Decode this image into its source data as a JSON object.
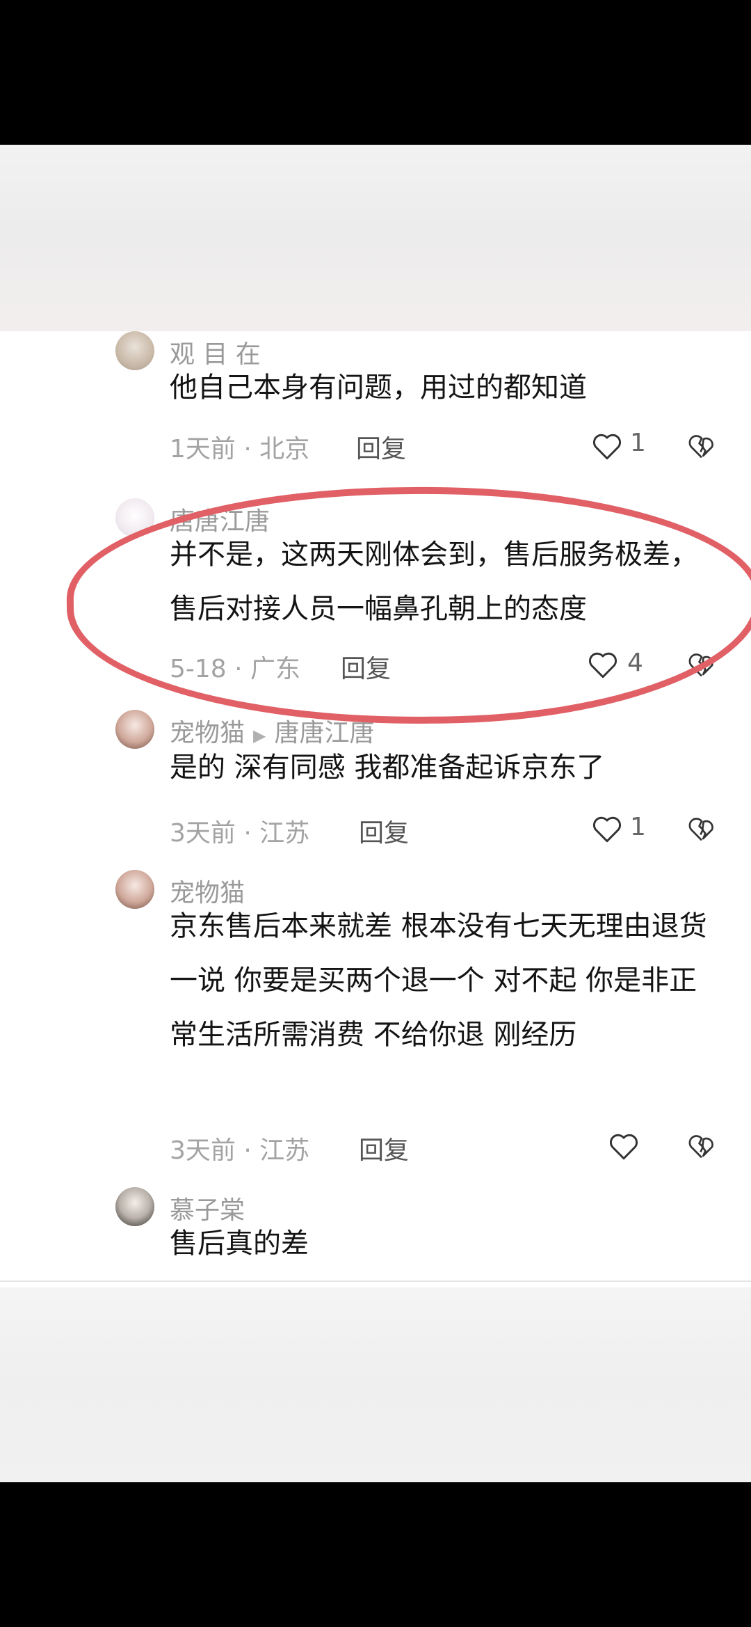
{
  "comments": [
    {
      "name": "观 目 在",
      "text": "他自己本身有问题，用过的都知道",
      "time": "1天前 · 北京",
      "reply": "回复",
      "likes": "1"
    },
    {
      "name": "唐唐江唐",
      "text": "并不是，这两天刚体会到，售后服务极差，售后对接人员一幅鼻孔朝上的态度",
      "time": "5-18 · 广东",
      "reply": "回复",
      "likes": "4"
    },
    {
      "name": "宠物猫",
      "reply_to": "唐唐江唐",
      "text": "是的 深有同感 我都准备起诉京东了",
      "time": "3天前 · 江苏",
      "reply": "回复",
      "likes": "1"
    },
    {
      "name": "宠物猫",
      "text": "京东售后本来就差 根本没有七天无理由退货一说 你要是买两个退一个 对不起 你是非正常生活所需消费 不给你退 刚经历",
      "time": "3天前 · 江苏",
      "reply": "回复",
      "likes": ""
    },
    {
      "name": "慕子棠",
      "text": "售后真的差"
    }
  ],
  "colors": {
    "highlight": "#e06066"
  },
  "icons": {
    "like": "heart-outline-icon",
    "dislike": "broken-heart-icon"
  }
}
